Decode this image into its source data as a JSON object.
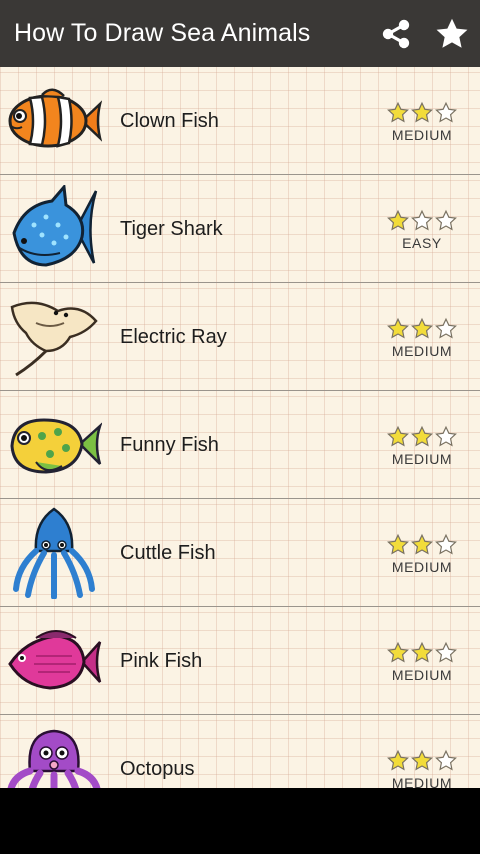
{
  "app": {
    "title": "How To Draw Sea Animals",
    "topbar_color": "#3a3836",
    "actions": [
      {
        "name": "share",
        "icon": "share-icon"
      },
      {
        "name": "favorite",
        "icon": "star-icon"
      }
    ]
  },
  "items": [
    {
      "name": "Clown Fish",
      "difficulty": "MEDIUM",
      "stars_filled": 2,
      "stars_total": 3,
      "icon": "clown-fish-icon"
    },
    {
      "name": "Tiger Shark",
      "difficulty": "EASY",
      "stars_filled": 1,
      "stars_total": 3,
      "icon": "tiger-shark-icon"
    },
    {
      "name": "Electric Ray",
      "difficulty": "MEDIUM",
      "stars_filled": 2,
      "stars_total": 3,
      "icon": "electric-ray-icon"
    },
    {
      "name": "Funny Fish",
      "difficulty": "MEDIUM",
      "stars_filled": 2,
      "stars_total": 3,
      "icon": "funny-fish-icon"
    },
    {
      "name": "Cuttle Fish",
      "difficulty": "MEDIUM",
      "stars_filled": 2,
      "stars_total": 3,
      "icon": "cuttle-fish-icon"
    },
    {
      "name": "Pink Fish",
      "difficulty": "MEDIUM",
      "stars_filled": 2,
      "stars_total": 3,
      "icon": "pink-fish-icon"
    },
    {
      "name": "Octopus",
      "difficulty": "MEDIUM",
      "stars_filled": 2,
      "stars_total": 3,
      "icon": "octopus-icon"
    }
  ],
  "colors": {
    "star_filled": "#f2dc3a",
    "star_empty": "#ffffff",
    "star_outline": "#7a7262"
  }
}
